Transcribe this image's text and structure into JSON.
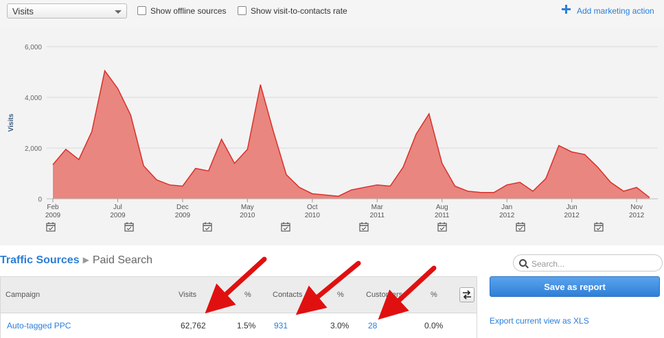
{
  "controls": {
    "metric_select": "Visits",
    "offline_sources_label": "Show offline sources",
    "visit_to_contacts_label": "Show visit-to-contacts rate",
    "add_marketing_action": "Add marketing action"
  },
  "chart_data": {
    "type": "area",
    "ylabel": "Visits",
    "ylim": [
      0,
      6000
    ],
    "yticks": [
      "6,000",
      "4,000",
      "2,000",
      "0"
    ],
    "ytick_values": [
      6000,
      4000,
      2000,
      0
    ],
    "x_ticks": [
      {
        "month": "Feb",
        "year": "2009"
      },
      {
        "month": "Jul",
        "year": "2009"
      },
      {
        "month": "Dec",
        "year": "2009"
      },
      {
        "month": "May",
        "year": "2010"
      },
      {
        "month": "Oct",
        "year": "2010"
      },
      {
        "month": "Mar",
        "year": "2011"
      },
      {
        "month": "Aug",
        "year": "2011"
      },
      {
        "month": "Jan",
        "year": "2012"
      },
      {
        "month": "Jun",
        "year": "2012"
      },
      {
        "month": "Nov",
        "year": "2012"
      }
    ],
    "x": [
      "2009-02",
      "2009-03",
      "2009-04",
      "2009-05",
      "2009-06",
      "2009-07",
      "2009-08",
      "2009-09",
      "2009-10",
      "2009-11",
      "2009-12",
      "2010-01",
      "2010-02",
      "2010-03",
      "2010-04",
      "2010-05",
      "2010-06",
      "2010-07",
      "2010-08",
      "2010-09",
      "2010-10",
      "2010-11",
      "2010-12",
      "2011-01",
      "2011-02",
      "2011-03",
      "2011-04",
      "2011-05",
      "2011-06",
      "2011-07",
      "2011-08",
      "2011-09",
      "2011-10",
      "2011-11",
      "2011-12",
      "2012-01",
      "2012-02",
      "2012-03",
      "2012-04",
      "2012-05",
      "2012-06",
      "2012-07",
      "2012-08",
      "2012-09",
      "2012-10",
      "2012-11",
      "2012-12"
    ],
    "series": [
      {
        "values": [
          1350,
          1950,
          1550,
          2650,
          5050,
          4350,
          3300,
          1300,
          750,
          550,
          500,
          1200,
          1100,
          2350,
          1400,
          1950,
          4500,
          2650,
          950,
          450,
          200,
          150,
          100,
          350,
          450,
          550,
          500,
          1250,
          2550,
          3350,
          1400,
          500,
          300,
          250,
          250,
          550,
          650,
          300,
          800,
          2100,
          1850,
          1750,
          1250,
          650,
          300,
          450,
          50
        ]
      }
    ],
    "colors": {
      "fill": "#e8867f",
      "line": "#d9302a"
    },
    "grid": true,
    "calendar_markers": 8
  },
  "breadcrumb": {
    "root": "Traffic Sources",
    "current": "Paid Search"
  },
  "search": {
    "placeholder": "Search...",
    "value": ""
  },
  "table": {
    "headers": {
      "campaign": "Campaign",
      "visits": "Visits",
      "visits_pct": "%",
      "contacts": "Contacts",
      "contacts_pct": "%",
      "customers": "Customers",
      "customers_pct": "%"
    },
    "rows": [
      {
        "campaign": "Auto-tagged PPC",
        "visits": "62,762",
        "visits_pct": "1.5%",
        "contacts": "931",
        "contacts_pct": "3.0%",
        "customers": "28",
        "customers_pct": "0.0%"
      }
    ]
  },
  "actions": {
    "save_report": "Save as report",
    "export_xls": "Export current view as XLS"
  }
}
